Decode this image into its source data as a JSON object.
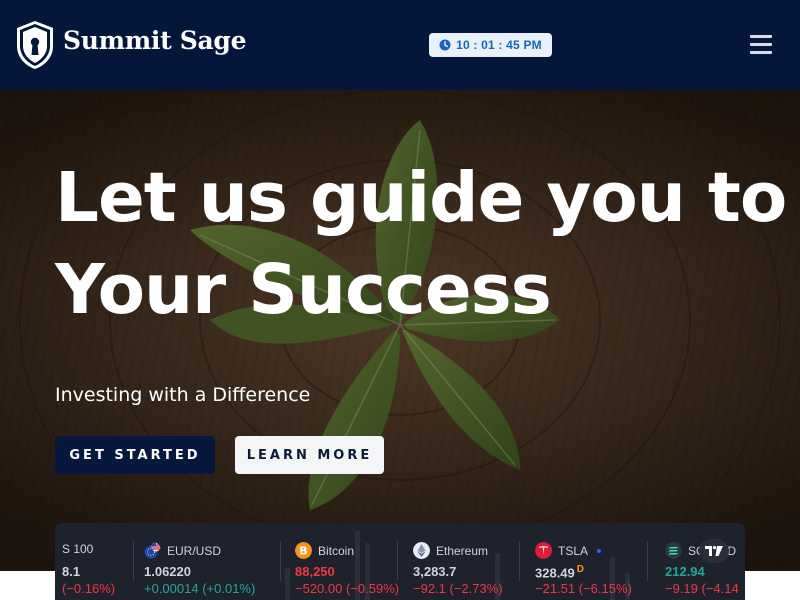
{
  "brand": {
    "name": "Summit Sage",
    "logo_icon": "keyhole-shield-icon"
  },
  "clock": {
    "icon": "clock-icon",
    "time": "10 : 01 : 45 PM"
  },
  "menu": {
    "icon": "hamburger-menu-icon"
  },
  "hero": {
    "title_line1": "Let us guide you to",
    "title_line2": "Your Success",
    "subtitle": "Investing with a Difference",
    "primary_button": "GET STARTED",
    "secondary_button": "LEARN MORE"
  },
  "ticker": {
    "items": [
      {
        "name": "S 100",
        "price": "8.1",
        "change": "(−0.16%)",
        "direction": "down",
        "logo": ""
      },
      {
        "name": "EUR/USD",
        "price": "1.06220",
        "change": "+0.00014 (+0.01%)",
        "direction": "up",
        "logo": "eu-us-flags-icon"
      },
      {
        "name": "Bitcoin",
        "price": "88,250",
        "change": "−520.00 (−0.59%)",
        "direction": "down",
        "logo": "bitcoin-icon"
      },
      {
        "name": "Ethereum",
        "price": "3,283.7",
        "change": "−92.1 (−2.73%)",
        "direction": "down",
        "logo": "ethereum-icon"
      },
      {
        "name": "TSLA",
        "price": "328.49",
        "price_suffix": "D",
        "change": "−21.51 (−6.15%)",
        "direction": "down",
        "logo": "tesla-icon"
      },
      {
        "name": "SO",
        "name_tail": "D",
        "price": "212.94",
        "change": "−9.19 (−4.14",
        "direction": "down",
        "price_direction": "up",
        "logo": "solana-icon"
      }
    ],
    "badge_icon": "tradingview-icon"
  },
  "colors": {
    "header_bg": "#04163a",
    "clock_text": "#1565c0",
    "primary_btn": "#06183d",
    "ticker_bg": "#1e222d",
    "up": "#26a69a",
    "down": "#f23645"
  }
}
